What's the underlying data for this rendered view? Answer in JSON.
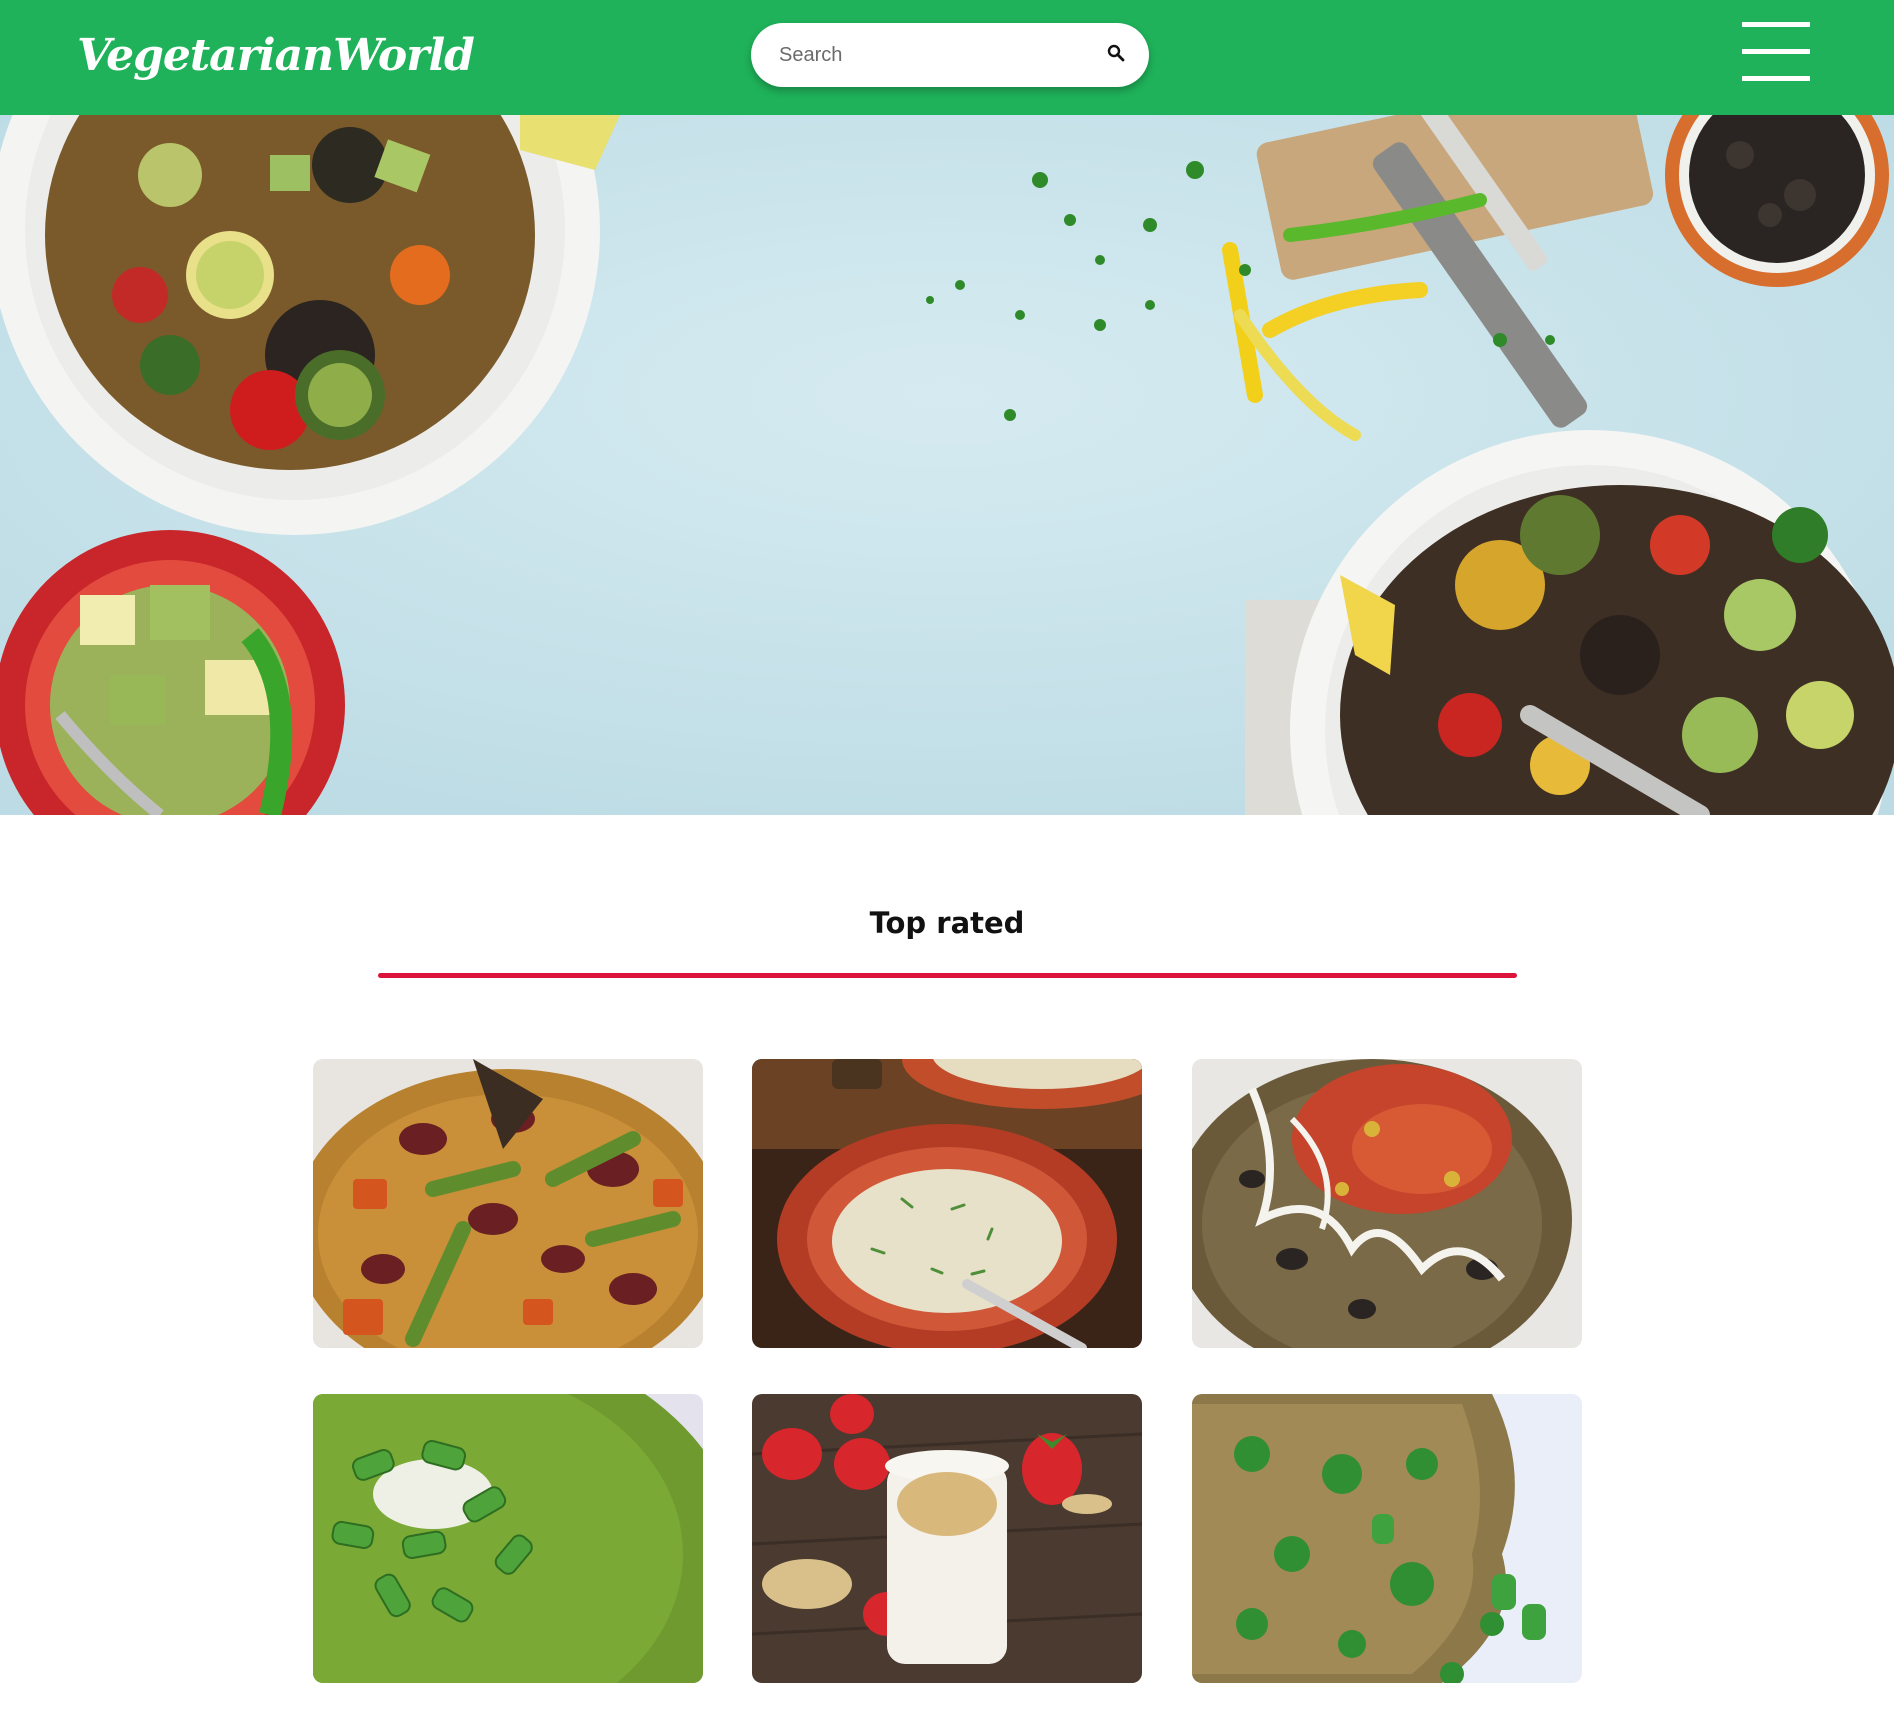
{
  "header": {
    "logo": "VegetarianWorld",
    "search": {
      "placeholder": "Search"
    },
    "brand_color": "#1fb25a",
    "icons": {
      "search": "search-icon",
      "menu": "hamburger-menu-icon"
    }
  },
  "hero": {
    "image": "vegetarian-dishes-banner"
  },
  "top_rated": {
    "title": "Top rated",
    "accent_color": "#dc143c",
    "cards": [
      {
        "image": "bean-vegetable-rice-stew"
      },
      {
        "image": "creamy-soup-bowl"
      },
      {
        "image": "rice-beans-salsa"
      },
      {
        "image": "green-pea-soup"
      },
      {
        "image": "strawberry-smoothie"
      },
      {
        "image": "vegetable-fried-rice"
      }
    ]
  }
}
